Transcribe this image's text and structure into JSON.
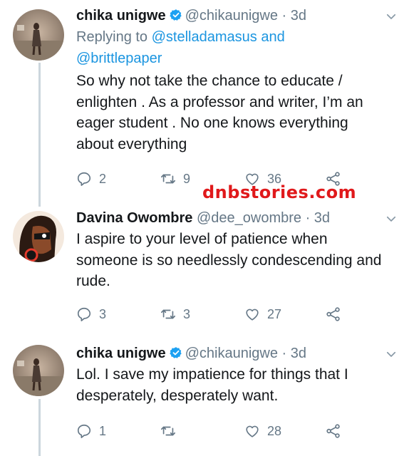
{
  "tweets": [
    {
      "name": "chika unigwe",
      "handle": "@chikaunigwe",
      "time": "· 3d",
      "verified": true,
      "reply_prefix": "Replying to",
      "reply_user1": "@stelladamasus",
      "reply_and": "and",
      "reply_user2": "@brittlepaper",
      "text": "So why not take the chance to educate / enlighten . As a professor and writer, I’m an eager student . No one knows everything about everything",
      "replies": "2",
      "retweets": "9",
      "likes": "36"
    },
    {
      "name": "Davina Owombre",
      "handle": "@dee_owombre",
      "time": "· 3d",
      "verified": false,
      "text": "I aspire to your level of patience when someone is so needlessly condescending and rude.",
      "replies": "3",
      "retweets": "3",
      "likes": "27"
    },
    {
      "name": "chika unigwe",
      "handle": "@chikaunigwe",
      "time": "· 3d",
      "verified": true,
      "text": "Lol. I save my impatience for things that I desperately, desperately want.",
      "replies": "1",
      "retweets": "",
      "likes": "28"
    }
  ],
  "watermark": "dnbstories.com",
  "colors": {
    "verified": "#1da1f2",
    "link": "#1b95e0",
    "muted": "#657786",
    "watermark": "#e0191b"
  },
  "icons": [
    "reply-icon",
    "retweet-icon",
    "like-icon",
    "share-icon",
    "chevron-down-icon",
    "verified-badge-icon"
  ]
}
